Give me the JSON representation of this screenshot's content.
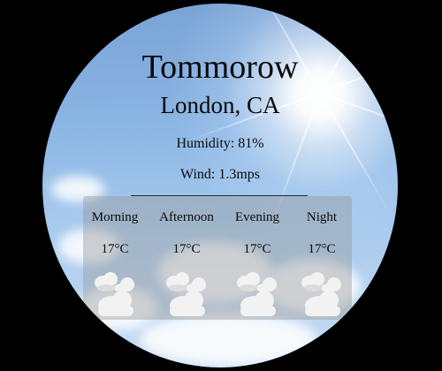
{
  "header": {
    "title": "Tommorow",
    "location": "London, CA"
  },
  "details": {
    "humidity": "Humidity: 81%",
    "wind": "Wind: 1.3mps"
  },
  "forecast": [
    {
      "period": "Morning",
      "temp": "17°C",
      "icon": "cloudy-icon"
    },
    {
      "period": "Afternoon",
      "temp": "17°C",
      "icon": "cloudy-icon"
    },
    {
      "period": "Evening",
      "temp": "17°C",
      "icon": "cloudy-icon"
    },
    {
      "period": "Night",
      "temp": "17°C",
      "icon": "cloudy-icon"
    }
  ],
  "colors": {
    "background": "#000000",
    "text": "#0a0a0a",
    "panel": "rgba(150,150,150,0.42)",
    "icon": "#f2f2f2"
  }
}
